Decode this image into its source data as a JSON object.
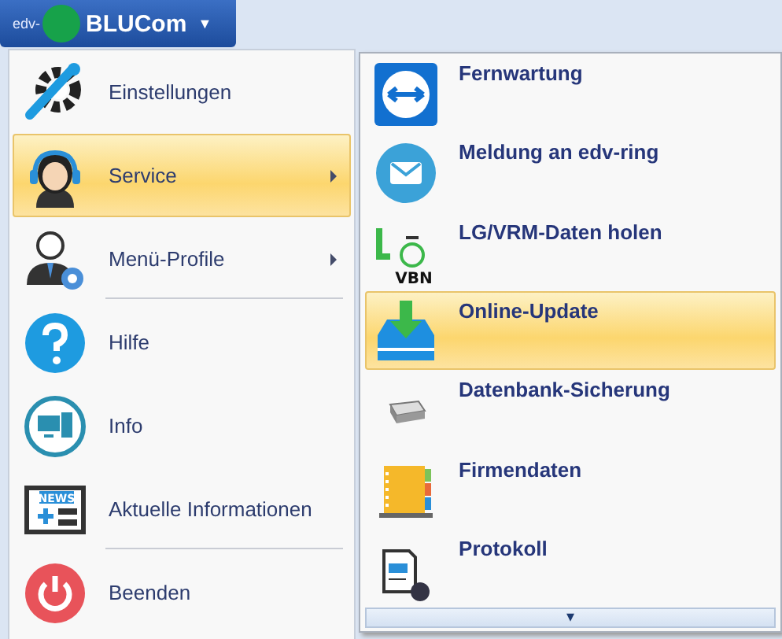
{
  "app_button": {
    "logo_text": "edv-",
    "label": "BLUCom",
    "caret": "▼"
  },
  "menu": [
    {
      "label": "Einstellungen",
      "selected": false,
      "has_submenu": false,
      "separator_after": false
    },
    {
      "label": "Service",
      "selected": true,
      "has_submenu": true,
      "separator_after": false
    },
    {
      "label": "Menü-Profile",
      "selected": false,
      "has_submenu": true,
      "separator_after": true
    },
    {
      "label": "Hilfe",
      "selected": false,
      "has_submenu": false,
      "separator_after": false
    },
    {
      "label": "Info",
      "selected": false,
      "has_submenu": false,
      "separator_after": false
    },
    {
      "label": "Aktuelle Informationen",
      "selected": false,
      "has_submenu": false,
      "separator_after": true
    },
    {
      "label": "Beenden",
      "selected": false,
      "has_submenu": false,
      "separator_after": false
    }
  ],
  "submenu": {
    "items": [
      {
        "label": "Fernwartung",
        "selected": false
      },
      {
        "label": "Meldung an edv-ring",
        "selected": false
      },
      {
        "label": "LG/VRM-Daten holen",
        "selected": false
      },
      {
        "label": "Online-Update",
        "selected": true
      },
      {
        "label": "Datenbank-Sicherung",
        "selected": false
      },
      {
        "label": "Firmendaten",
        "selected": false
      },
      {
        "label": "Protokoll",
        "selected": false
      }
    ],
    "scroll_down": "▾"
  },
  "icon_texts": {
    "vbn": "VBN",
    "news": "NEWS"
  }
}
